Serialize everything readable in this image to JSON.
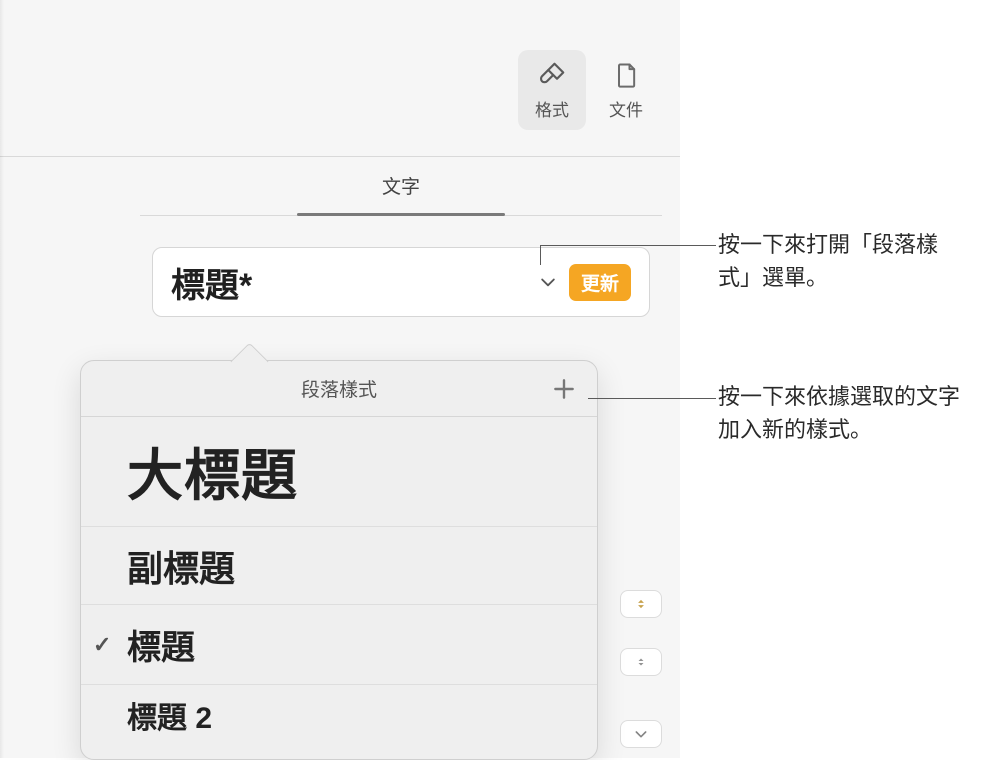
{
  "top_tabs": {
    "format": "格式",
    "document": "文件"
  },
  "section_tab": "文字",
  "style_button": {
    "current_style": "標題*",
    "update_label": "更新"
  },
  "popover": {
    "title": "段落樣式",
    "items": [
      {
        "label": "大標題",
        "selected": false
      },
      {
        "label": "副標題",
        "selected": false
      },
      {
        "label": "標題",
        "selected": true
      },
      {
        "label": "標題 2",
        "selected": false
      }
    ]
  },
  "callouts": {
    "open_menu": "按一下來打開「段落樣式」選單。",
    "add_style": "按一下來依據選取的文字加入新的樣式。"
  },
  "icons": {
    "format": "brush-icon",
    "document": "document-icon",
    "chevron": "chevron-down-icon",
    "plus": "plus-icon",
    "check": "check-icon"
  }
}
